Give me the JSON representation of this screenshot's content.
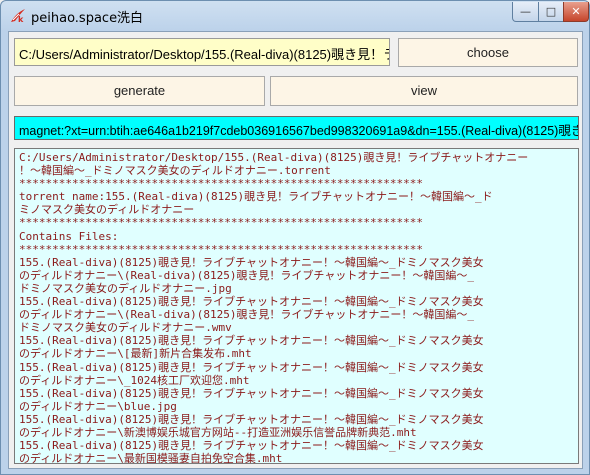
{
  "window": {
    "title": "peihao.space洗白",
    "icon": "tk-feather-icon",
    "controls": {
      "minimize": "—",
      "maximize": "□",
      "close": "✕"
    }
  },
  "path_input": {
    "value": "C:/Users/Administrator/Desktop/155.(Real-diva)(8125)覗き見！ライブチャットオナニー！～韓国編～_ドミノマスク美女のディルドオナニー.torrent"
  },
  "buttons": {
    "choose": "choose",
    "generate": "generate",
    "view": "view"
  },
  "magnet": {
    "value": "magnet:?xt=urn:btih:ae646a1b219f7cdeb036916567bed998320691a9&dn=155.(Real-diva)(8125)覗き見！ライブチャットオナニー！～韓国編～_ドミノマスク美女のディルドオナニー"
  },
  "output_lines": [
    "C:/Users/Administrator/Desktop/155.(Real-diva)(8125)覗き見！ライブチャットオナニー",
    "！～韓国編～_ドミノマスク美女のディルドオナニー.torrent",
    "*************************************************************",
    "torrent name:155.(Real-diva)(8125)覗き見！ライブチャットオナニー！～韓国編～_ド",
    "ミノマスク美女のディルドオナニー",
    "*************************************************************",
    "Contains Files:",
    "*************************************************************",
    "155.(Real-diva)(8125)覗き見！ライブチャットオナニー！～韓国編～_ドミノマスク美女",
    "のディルドオナニー\\(Real-diva)(8125)覗き見！ライブチャットオナニー！～韓国編～_",
    "ドミノマスク美女のディルドオナニー.jpg",
    "155.(Real-diva)(8125)覗き見！ライブチャットオナニー！～韓国編～_ドミノマスク美女",
    "のディルドオナニー\\(Real-diva)(8125)覗き見！ライブチャットオナニー！～韓国編～_",
    "ドミノマスク美女のディルドオナニー.wmv",
    "155.(Real-diva)(8125)覗き見！ライブチャットオナニー！～韓国編～_ドミノマスク美女",
    "のディルドオナニー\\[最新]新片合集发布.mht",
    "155.(Real-diva)(8125)覗き見！ライブチャットオナニー！～韓国編～_ドミノマスク美女",
    "のディルドオナニー\\_1024核工厂欢迎您.mht",
    "155.(Real-diva)(8125)覗き見！ライブチャットオナニー！～韓国編～_ドミノマスク美女",
    "のディルドオナニー\\blue.jpg",
    "155.(Real-diva)(8125)覗き見！ライブチャットオナニー！～韓国編～_ドミノマスク美女",
    "のディルドオナニー\\新澳博娱乐城官方网站--打造亚洲娱乐信誉品牌新典范.mht",
    "155.(Real-diva)(8125)覗き見！ライブチャットオナニー！～韓国編～_ドミノマスク美女",
    "のディルドオナニー\\最新国模骚妻自拍免空合集.mht"
  ]
}
